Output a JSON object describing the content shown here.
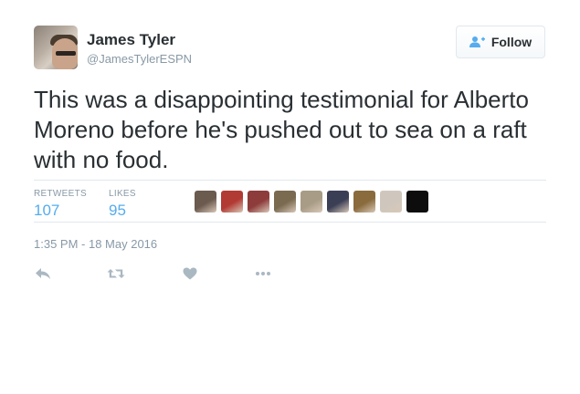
{
  "user": {
    "name": "James Tyler",
    "handle": "@JamesTylerESPN"
  },
  "follow_button": {
    "label": "Follow"
  },
  "tweet": {
    "text": "This was a disappointing testimonial for Alberto Moreno before he's pushed out to sea on a raft with no food."
  },
  "stats": {
    "retweets_label": "RETWEETS",
    "retweets": "107",
    "likes_label": "LIKES",
    "likes": "95"
  },
  "likers": [
    {
      "color": "#6b5a4e"
    },
    {
      "color": "#b23a34"
    },
    {
      "color": "#8e3b3b"
    },
    {
      "color": "#7a6a50"
    },
    {
      "color": "#a89c86"
    },
    {
      "color": "#3b3f55"
    },
    {
      "color": "#8a6b3d"
    },
    {
      "color": "#cfc7bd"
    },
    {
      "color": "#0d0d0d"
    }
  ],
  "timestamp": "1:35 PM - 18 May 2016",
  "actions": {
    "reply_icon": "reply-icon",
    "retweet_icon": "retweet-icon",
    "like_icon": "heart-icon",
    "more_icon": "more-icon"
  },
  "colors": {
    "accent": "#55acee",
    "muted": "#8899a6",
    "text": "#292f33",
    "action_icon": "#aab8c2"
  }
}
